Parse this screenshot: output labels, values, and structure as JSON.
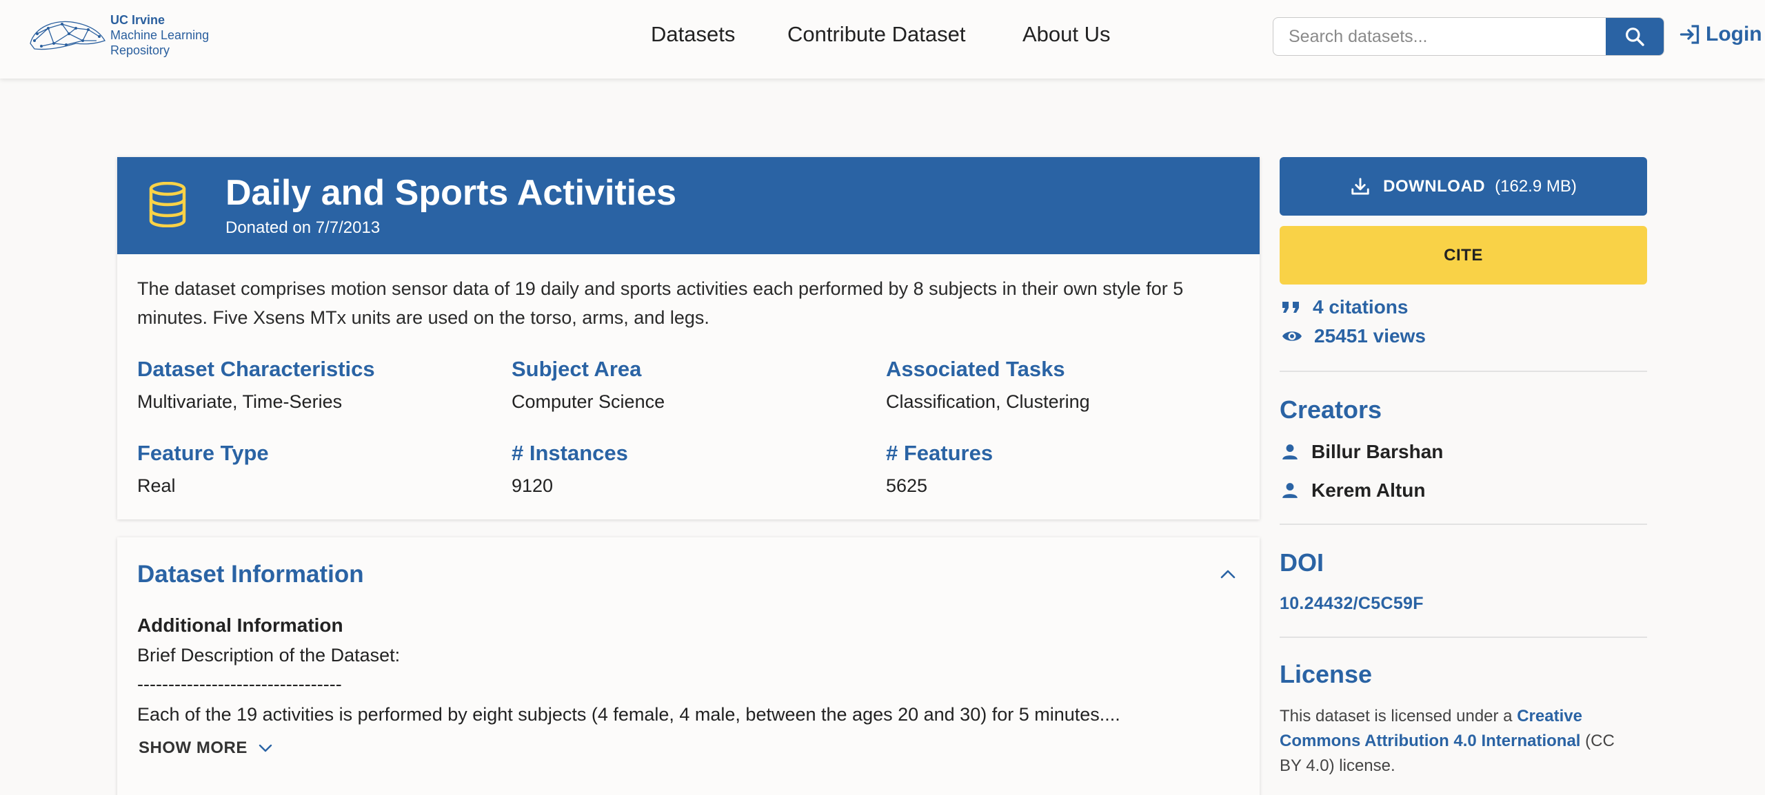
{
  "header": {
    "logo_line1": "UC Irvine",
    "logo_line2": "Machine Learning",
    "logo_line3": "Repository",
    "nav": [
      "Datasets",
      "Contribute Dataset",
      "About Us"
    ],
    "search_placeholder": "Search datasets...",
    "login_label": "Login"
  },
  "dataset": {
    "title": "Daily and Sports Activities",
    "donated": "Donated on 7/7/2013",
    "description": "The dataset comprises motion sensor data of 19 daily and sports activities each performed by 8 subjects in their own style for 5 minutes. Five Xsens MTx units are used on the torso, arms, and legs.",
    "attributes": [
      {
        "label": "Dataset Characteristics",
        "value": "Multivariate, Time-Series"
      },
      {
        "label": "Subject Area",
        "value": "Computer Science"
      },
      {
        "label": "Associated Tasks",
        "value": "Classification, Clustering"
      },
      {
        "label": "Feature Type",
        "value": "Real"
      },
      {
        "label": "# Instances",
        "value": "9120"
      },
      {
        "label": "# Features",
        "value": "5625"
      }
    ]
  },
  "info": {
    "heading": "Dataset Information",
    "subheading": "Additional Information",
    "lines": [
      "Brief Description of the Dataset:",
      "---------------------------------",
      "Each of the 19 activities is performed by eight subjects (4 female, 4 male, between the ages 20 and 30) for 5 minutes...."
    ],
    "show_more": "SHOW MORE"
  },
  "sidebar": {
    "download_label": "DOWNLOAD",
    "download_size": "(162.9 MB)",
    "cite_label": "CITE",
    "citations": "4 citations",
    "views": "25451 views",
    "creators_heading": "Creators",
    "creators": [
      "Billur Barshan",
      "Kerem Altun"
    ],
    "doi_heading": "DOI",
    "doi": "10.24432/C5C59F",
    "license_heading": "License",
    "license_prefix": "This dataset is licensed under a ",
    "license_link": "Creative Commons Attribution 4.0 International",
    "license_suffix": " (CC BY 4.0) license."
  },
  "colors": {
    "primary": "#2a63a4",
    "cite": "#f9d247",
    "db_icon": "#f9d247"
  }
}
